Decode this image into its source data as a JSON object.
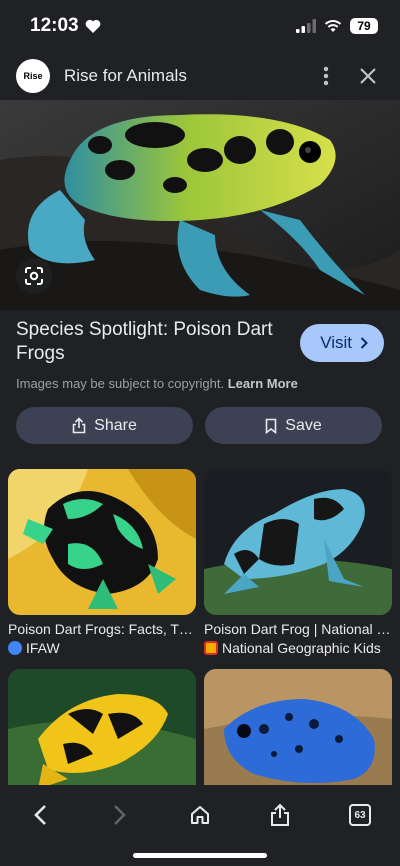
{
  "status": {
    "time": "12:03",
    "battery": "79"
  },
  "header": {
    "site_logo_text": "Rise",
    "site_name": "Rise for Animals"
  },
  "result": {
    "title": "Species Spotlight: Poison Dart Frogs",
    "visit_label": "Visit",
    "copyright_text": "Images may be subject to copyright.",
    "learn_more": "Learn More"
  },
  "actions": {
    "share_label": "Share",
    "save_label": "Save"
  },
  "related": [
    {
      "title": "Poison Dart Frogs: Facts, Threats & Conservation",
      "source": "IFAW",
      "source_color": "#4285f4"
    },
    {
      "title": "Poison Dart Frog | National Geographic Kids",
      "source": "National Geographic Kids",
      "source_color": "#f9ab00"
    },
    {
      "title": "",
      "source": "",
      "source_color": ""
    },
    {
      "title": "",
      "source": "",
      "source_color": ""
    }
  ],
  "toolbar": {
    "tab_count": "63"
  },
  "colors": {
    "background": "#202124",
    "visit_bg": "#a8c7fa",
    "action_bg": "#3c4254"
  }
}
